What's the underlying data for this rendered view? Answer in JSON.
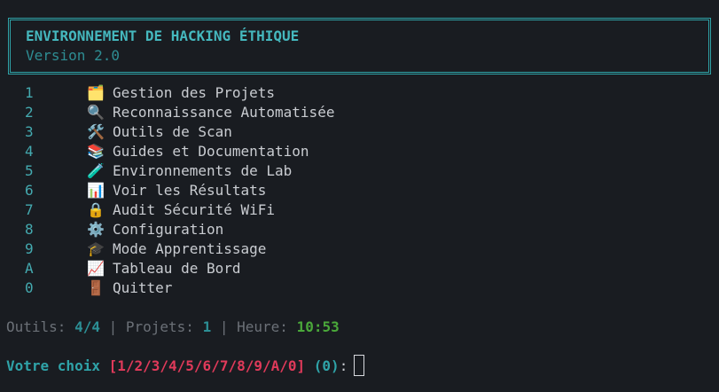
{
  "header": {
    "title": "ENVIRONNEMENT DE HACKING ÉTHIQUE",
    "version": "Version 2.0"
  },
  "menu": {
    "items": [
      {
        "key": "1",
        "icon": "🗂️",
        "icon_name": "card-index-dividers-icon",
        "label": "Gestion des Projets"
      },
      {
        "key": "2",
        "icon": "🔍",
        "icon_name": "magnifying-glass-icon",
        "label": "Reconnaissance Automatisée"
      },
      {
        "key": "3",
        "icon": "🛠️",
        "icon_name": "tools-icon",
        "label": "Outils de Scan"
      },
      {
        "key": "4",
        "icon": "📚",
        "icon_name": "books-icon",
        "label": "Guides et Documentation"
      },
      {
        "key": "5",
        "icon": "🧪",
        "icon_name": "test-tube-icon",
        "label": "Environnements de Lab"
      },
      {
        "key": "6",
        "icon": "📊",
        "icon_name": "bar-chart-icon",
        "label": "Voir les Résultats"
      },
      {
        "key": "7",
        "icon": "🔒",
        "icon_name": "lock-icon",
        "label": "Audit Sécurité WiFi"
      },
      {
        "key": "8",
        "icon": "⚙️",
        "icon_name": "gear-icon",
        "label": "Configuration"
      },
      {
        "key": "9",
        "icon": "🎓",
        "icon_name": "graduation-cap-icon",
        "label": "Mode Apprentissage"
      },
      {
        "key": "A",
        "icon": "📈",
        "icon_name": "chart-increasing-icon",
        "label": "Tableau de Bord"
      },
      {
        "key": "0",
        "icon": "🚪",
        "icon_name": "door-icon",
        "label": "Quitter"
      }
    ]
  },
  "status": {
    "tools_label": "Outils: ",
    "tools_value": "4/4",
    "sep1": " | ",
    "projects_label": "Projets: ",
    "projects_value": "1",
    "sep2": " | ",
    "time_label": "Heure: ",
    "time_value": "10:53"
  },
  "prompt": {
    "label": "Votre choix ",
    "choices": "[1/2/3/4/5/6/7/8/9/A/0]",
    "default": " (0)",
    "colon": ":",
    "input_value": ""
  },
  "colors": {
    "background": "#191c21",
    "accent_cyan": "#2fa3a8",
    "choices_red": "#e03a5a",
    "time_green": "#4aa83a",
    "text": "#c9ccd1",
    "muted": "#6b7077"
  }
}
